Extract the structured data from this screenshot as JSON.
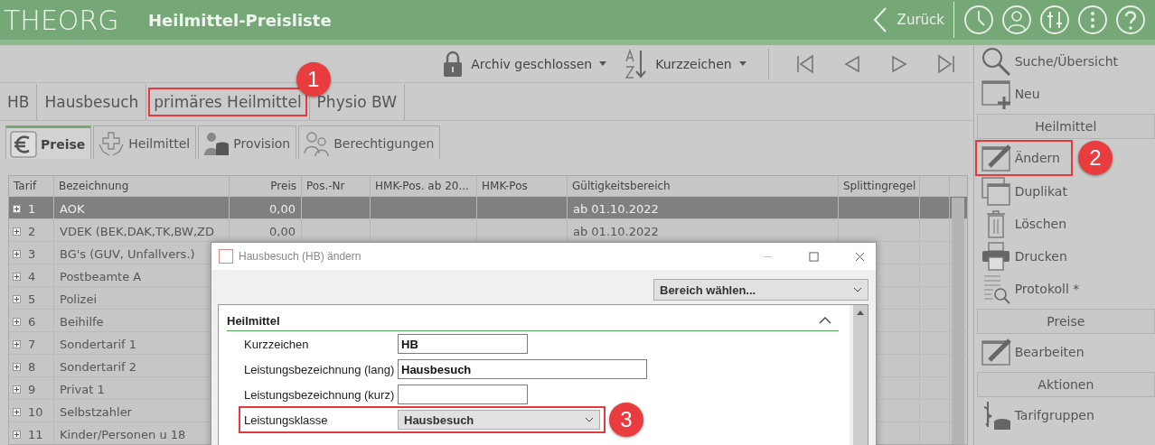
{
  "header": {
    "logo": "THEORG",
    "title": "Heilmittel-Preisliste",
    "back": "Zurück"
  },
  "toolbar": {
    "archive": "Archiv geschlossen",
    "sort": "Kurzzeichen"
  },
  "record": [
    {
      "text": "HB"
    },
    {
      "text": "Hausbesuch"
    },
    {
      "text": "primäres Heilmittel",
      "callout": "1"
    },
    {
      "text": "Physio BW"
    }
  ],
  "tabs": [
    {
      "label": "Preise",
      "selected": true
    },
    {
      "label": "Heilmittel",
      "selected": false
    },
    {
      "label": "Provision",
      "selected": false
    },
    {
      "label": "Berechtigungen",
      "selected": false
    }
  ],
  "table": {
    "columns": [
      "Tarif",
      "Bezeichnung",
      "Preis",
      "Pos.-Nr",
      "HMK-Pos. ab 20...",
      "HMK-Pos",
      "Gültigkeitsbereich",
      "Splittingregel"
    ],
    "rows": [
      {
        "tarif": "1",
        "name": "AOK",
        "price": "0,00",
        "valid": "ab 01.10.2022",
        "selected": true
      },
      {
        "tarif": "2",
        "name": "VDEK (BEK,DAK,TK,BW,ZD",
        "price": "0,00",
        "valid": "ab 01.10.2022",
        "selected": false
      },
      {
        "tarif": "3",
        "name": "BG's (GUV, Unfallvers.)",
        "selected": false
      },
      {
        "tarif": "4",
        "name": "Postbeamte A",
        "selected": false
      },
      {
        "tarif": "5",
        "name": "Polizei",
        "selected": false
      },
      {
        "tarif": "6",
        "name": "Beihilfe",
        "selected": false
      },
      {
        "tarif": "7",
        "name": "Sondertarif 1",
        "selected": false
      },
      {
        "tarif": "8",
        "name": "Sondertarif 2",
        "selected": false
      },
      {
        "tarif": "9",
        "name": "Privat 1",
        "selected": false
      },
      {
        "tarif": "10",
        "name": "Selbstzahler",
        "selected": false
      },
      {
        "tarif": "11",
        "name": "Kinder/Personen u 18",
        "selected": false
      }
    ]
  },
  "sidebar": {
    "items": [
      {
        "kind": "button",
        "label": "Suche/Übersicht"
      },
      {
        "kind": "button",
        "label": "Neu"
      },
      {
        "kind": "section",
        "label": "Heilmittel"
      },
      {
        "kind": "button",
        "label": "Ändern",
        "callout": "2"
      },
      {
        "kind": "button",
        "label": "Duplikat"
      },
      {
        "kind": "button",
        "label": "Löschen"
      },
      {
        "kind": "button",
        "label": "Drucken"
      },
      {
        "kind": "button",
        "label": "Protokoll *"
      },
      {
        "kind": "section",
        "label": "Preise"
      },
      {
        "kind": "button",
        "label": "Bearbeiten"
      },
      {
        "kind": "section",
        "label": "Aktionen"
      },
      {
        "kind": "button",
        "label": "Tarifgruppen"
      }
    ]
  },
  "dialog": {
    "title": "Hausbesuch (HB) ändern",
    "area_select": "Bereich wählen...",
    "section": "Heilmittel",
    "fields": [
      {
        "kind": "text",
        "label": "Kurzzeichen",
        "value": "HB"
      },
      {
        "kind": "text",
        "label": "Leistungsbezeichnung (lang)",
        "value": "Hausbesuch"
      },
      {
        "kind": "text",
        "label": "Leistungsbezeichnung (kurz)"
      },
      {
        "kind": "select",
        "label": "Leistungsklasse",
        "value": "Hausbesuch",
        "callout": "3"
      }
    ]
  }
}
